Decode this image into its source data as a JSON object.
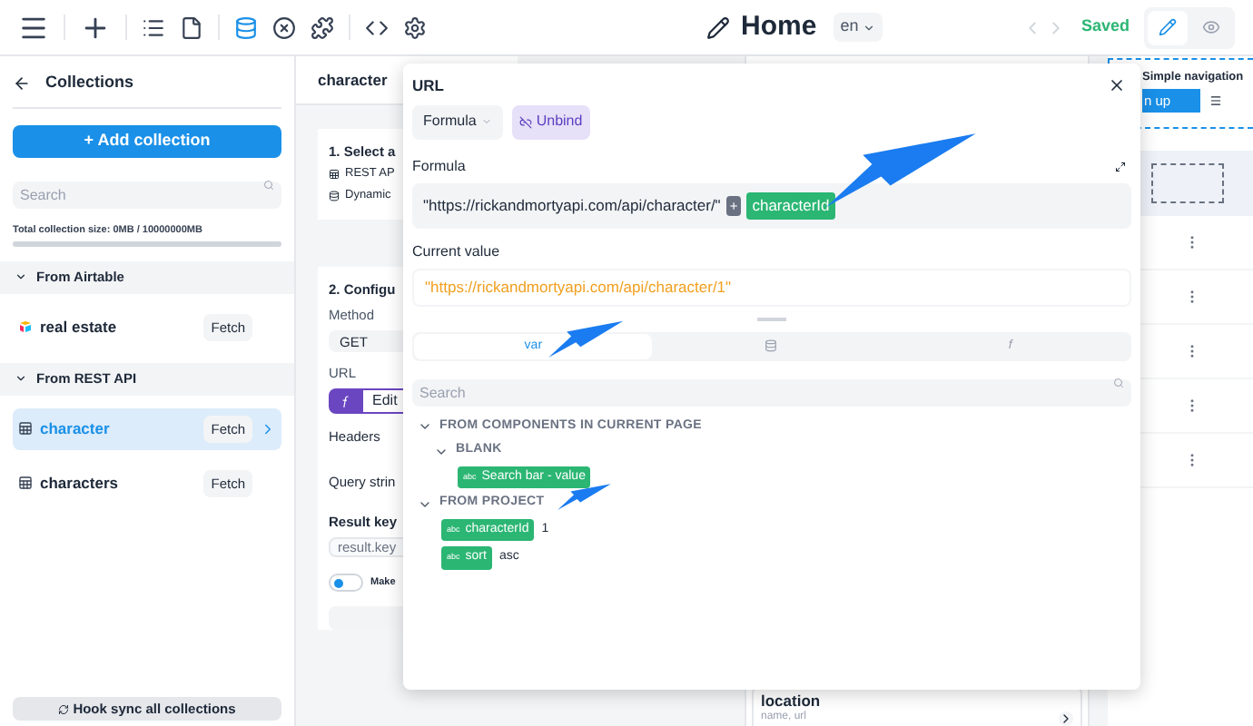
{
  "toolbar": {
    "tools": [
      {
        "selected": false
      },
      {
        "selected": false
      },
      {
        "selected": false
      },
      {
        "selected": false
      },
      {
        "selected": true
      },
      {
        "selected": false
      },
      {
        "selected": false
      },
      {
        "selected": false
      },
      {
        "selected": false
      }
    ],
    "page_title": "Home",
    "language": "en",
    "status": "Saved",
    "modes": [
      {
        "selected": true
      },
      {
        "selected": false
      }
    ]
  },
  "sidebar": {
    "title": "Collections",
    "add_button": "+ Add collection",
    "search": {
      "placeholder": "Search"
    },
    "size_text": "Total collection size: 0MB / 10000000MB",
    "size": {
      "level": 0
    },
    "groups": [
      {
        "title": "From Airtable",
        "expanded": true,
        "items": [
          {
            "name": "real estate",
            "kind": "airtable",
            "action": "Fetch",
            "selected": false
          }
        ]
      },
      {
        "title": "From REST API",
        "expanded": true,
        "items": [
          {
            "name": "character",
            "kind": "rest",
            "action": "Fetch",
            "selected": true
          },
          {
            "name": "characters",
            "kind": "rest",
            "action": "Fetch",
            "selected": false
          }
        ]
      }
    ],
    "footer_button": "Hook sync all collections"
  },
  "config": {
    "title": "character",
    "step1": {
      "title": "1. Select a",
      "options": [
        "REST AP",
        "Dynamic"
      ]
    },
    "step2": {
      "title": "2. Configu",
      "method_label": "Method",
      "method": "GET",
      "url_label": "URL",
      "edit_button": "Edit",
      "headers_label": "Headers",
      "query_label": "Query strin",
      "result_label": "Result key",
      "result_placeholder": "result.key",
      "toggle": {
        "label": "Make",
        "on": false
      }
    }
  },
  "canvas": {
    "nav_title": "Simple navigation",
    "nav_button": "n up",
    "card": {
      "title": "location",
      "subtitle": "name, url"
    }
  },
  "popup": {
    "title": "URL",
    "mode": "Formula",
    "unbind": "Unbind",
    "formula_label": "Formula",
    "formula": {
      "text": "\"https://rickandmortyapi.com/api/character/\"",
      "operator": "+",
      "variable": "characterId"
    },
    "current_label": "Current value",
    "current_value": "\"https://rickandmortyapi.com/api/character/1\"",
    "tabs": [
      {
        "kind": "text",
        "label": "var",
        "selected": true
      },
      {
        "kind": "database",
        "selected": false
      },
      {
        "kind": "function",
        "label": "f",
        "selected": false
      }
    ],
    "search": {
      "placeholder": "Search"
    },
    "tree": [
      {
        "label": "FROM COMPONENTS IN CURRENT PAGE",
        "expanded": true,
        "children": [
          {
            "label": "BLANK",
            "expanded": true,
            "children": [
              {
                "type_label": "abc",
                "name": "Search bar - value"
              }
            ]
          }
        ]
      },
      {
        "label": "FROM PROJECT",
        "expanded": true,
        "children": [
          {
            "type_label": "abc",
            "name": "characterId",
            "value": "1"
          },
          {
            "type_label": "abc",
            "name": "sort",
            "value": "asc"
          }
        ]
      }
    ]
  }
}
